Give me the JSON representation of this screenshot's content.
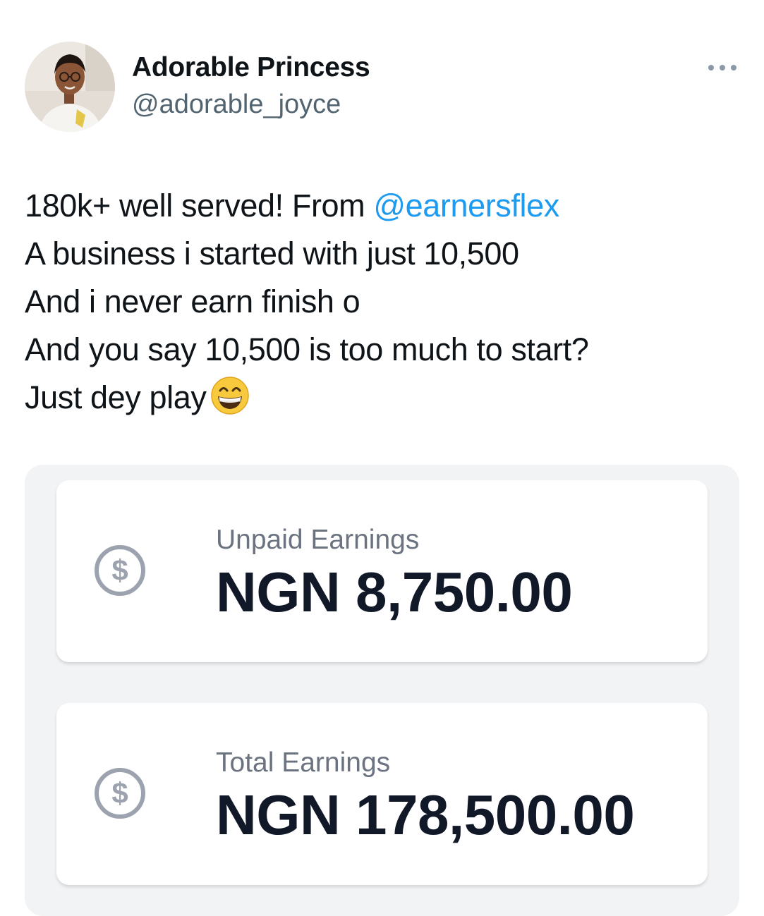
{
  "tweet": {
    "author": {
      "display_name": "Adorable Princess",
      "handle": "@adorable_joyce",
      "avatar": "profile-photo"
    },
    "more_icon": "more-dots-icon",
    "text": {
      "line1_prefix": "180k+ well served! From ",
      "line1_mention": "@earnersflex",
      "line2": "A business i started with just 10,500",
      "line3": "And i never earn finish o",
      "line4": "And you say 10,500 is too much to start?",
      "line5": "Just dey play",
      "line5_emoji": "grinning-face-emoji"
    },
    "mention_color": "#1d9bf0"
  },
  "media": {
    "cards": [
      {
        "icon": "dollar-coin-icon",
        "label": "Unpaid Earnings",
        "value": "NGN 8,750.00"
      },
      {
        "icon": "dollar-coin-icon",
        "label": "Total Earnings",
        "value": "NGN 178,500.00"
      }
    ]
  }
}
